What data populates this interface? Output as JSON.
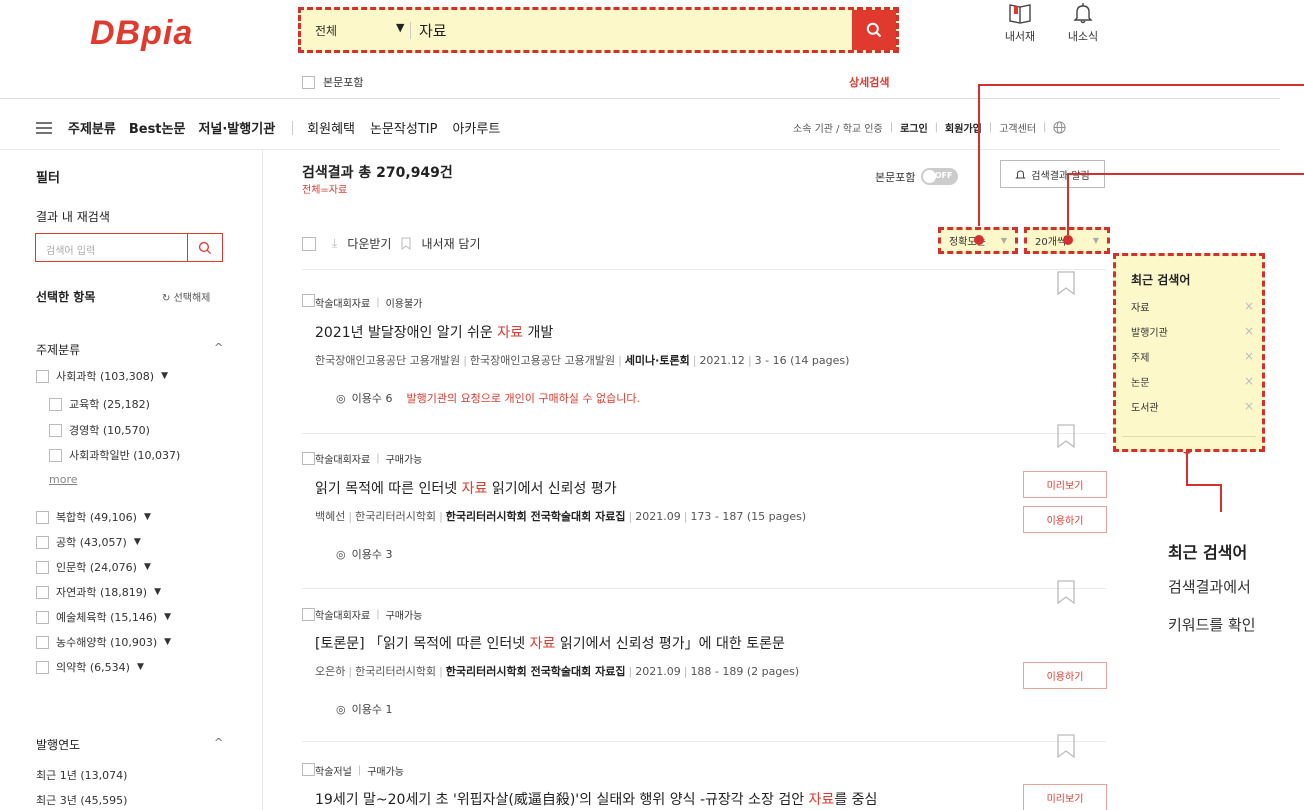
{
  "header": {
    "logo": "DBpia",
    "search": {
      "scope": "전체",
      "query": "자료"
    },
    "my_library": "내서재",
    "my_news": "내소식",
    "fulltext_checkbox": "본문포함",
    "advanced_search": "상세검색"
  },
  "nav": {
    "items": [
      "주제분류",
      "Best논문",
      "저널·발행기관"
    ],
    "items2": [
      "회원혜택",
      "논문작성TIP",
      "아카루트"
    ],
    "util": {
      "institution": "소속 기관 / 학교 인증",
      "login": "로그인",
      "signup": "회원가입",
      "support": "고객센터"
    }
  },
  "sidebar": {
    "title": "필터",
    "research_label": "결과 내 재검색",
    "research_placeholder": "검색어 입력",
    "selected_label": "선택한 항목",
    "clear_selection": "선택해제",
    "subject_label": "주제분류",
    "categories": [
      {
        "label": "사회과학 (103,308)",
        "expand": "▼",
        "sub": false
      },
      {
        "label": "교육학 (25,182)",
        "expand": "",
        "sub": true
      },
      {
        "label": "경영학 (10,570)",
        "expand": "",
        "sub": true
      },
      {
        "label": "사회과학일반 (10,037)",
        "expand": "",
        "sub": true
      }
    ],
    "more": "more",
    "categories2": [
      {
        "label": "복합학 (49,106)",
        "expand": "▼"
      },
      {
        "label": "공학 (43,057)",
        "expand": "▼"
      },
      {
        "label": "인문학 (24,076)",
        "expand": "▼"
      },
      {
        "label": "자연과학 (18,819)",
        "expand": "▼"
      },
      {
        "label": "예술체육학 (15,146)",
        "expand": "▼"
      },
      {
        "label": "농수해양학 (10,903)",
        "expand": "▼"
      },
      {
        "label": "의약학 (6,534)",
        "expand": "▼"
      }
    ],
    "year_label": "발행연도",
    "years": [
      "최근 1년 (13,074)",
      "최근 3년 (45,595)"
    ]
  },
  "results": {
    "total_label": "검색결과 총 270,949건",
    "query_sub": "전체=자료",
    "fulltext_toggle": "본문포함",
    "toggle_state": "OFF",
    "alert_button": "검색결과 알림",
    "download": "다운받기",
    "save_library": "내서재 담기",
    "sort": "정확도순",
    "per_page": "20개씩",
    "items": [
      {
        "type": "학술대회자료",
        "status": "이용불가",
        "title_pre": "2021년 발달장애인 알기 쉬운 ",
        "title_kw": "자료",
        "title_post": " 개발",
        "author": "한국장애인고용공단 고용개발원",
        "publisher": "한국장애인고용공단 고용개발원",
        "journal_pre": "세미나·토론회",
        "journal_kw": "",
        "date": "2021.12",
        "pages": "3 - 16 (14 pages)",
        "views": "이용수 6",
        "notice": "발행기관의 요청으로 개인이 구매하실 수 없습니다."
      },
      {
        "type": "학술대회자료",
        "status": "구매가능",
        "title_pre": "읽기 목적에 따른 인터넷 ",
        "title_kw": "자료",
        "title_post": " 읽기에서 신뢰성 평가",
        "author": "백혜선",
        "publisher": "한국리터러시학회",
        "journal_pre": "한국리터러시학회 전국학술대회 ",
        "journal_kw": "자료",
        "journal_post": "집",
        "date": "2021.09",
        "pages": "173 - 187 (15 pages)",
        "views": "이용수 3",
        "preview": "미리보기",
        "use": "이용하기"
      },
      {
        "type": "학술대회자료",
        "status": "구매가능",
        "title_pre": "[토론문] 「읽기 목적에 따른 인터넷 ",
        "title_kw": "자료",
        "title_post": " 읽기에서 신뢰성 평가」에 대한 토론문",
        "author": "오은하",
        "publisher": "한국리터러시학회",
        "journal_pre": "한국리터러시학회 전국학술대회 ",
        "journal_kw": "자료",
        "journal_post": "집",
        "date": "2021.09",
        "pages": "188 - 189 (2 pages)",
        "views": "이용수 1",
        "use": "이용하기"
      },
      {
        "type": "학술저널",
        "status": "구매가능",
        "title_pre": "19세기 말~20세기 초 '위핍자살(威逼自殺)'의 실태와 행위 양식 -규장각 소장 검안 ",
        "title_kw": "자료",
        "title_post": "를 중심",
        "preview": "미리보기"
      }
    ]
  },
  "recent": {
    "title": "최근 검색어",
    "keywords": [
      "자료",
      "발행기관",
      "주제",
      "논문",
      "도서관"
    ]
  },
  "callout": {
    "title": "최근 검색어",
    "line1": "검색결과에서",
    "line2": "키워드를 확인"
  },
  "colors": {
    "brand": "#e03a2f",
    "highlight_bg": "#fdf8c9",
    "annotation": "#d43030"
  }
}
